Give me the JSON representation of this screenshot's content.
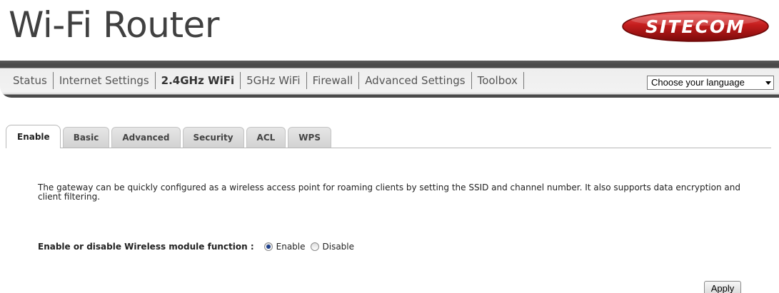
{
  "header": {
    "title": "Wi-Fi Router",
    "logo_text": "SITECOM",
    "logo_colors": {
      "primary": "#c41d1d",
      "dark": "#7a0a0a",
      "text": "#ffffff"
    }
  },
  "nav": {
    "items": [
      {
        "label": "Status"
      },
      {
        "label": "Internet Settings"
      },
      {
        "label": "2.4GHz WiFi",
        "active": true
      },
      {
        "label": "5GHz WiFi"
      },
      {
        "label": "Firewall"
      },
      {
        "label": "Advanced Settings"
      },
      {
        "label": "Toolbox"
      }
    ],
    "language_select": {
      "value": "Choose your language"
    }
  },
  "tabs": [
    {
      "label": "Enable",
      "active": true
    },
    {
      "label": "Basic"
    },
    {
      "label": "Advanced"
    },
    {
      "label": "Security"
    },
    {
      "label": "ACL"
    },
    {
      "label": "WPS"
    }
  ],
  "content": {
    "description": "The gateway can be quickly configured as a wireless access point for roaming clients by setting the SSID and channel number. It also supports data encryption and client filtering.",
    "wireless_module": {
      "label": "Enable or disable Wireless module function :",
      "options": [
        {
          "label": "Enable",
          "checked": true
        },
        {
          "label": "Disable",
          "checked": false
        }
      ]
    },
    "apply_label": "Apply"
  }
}
